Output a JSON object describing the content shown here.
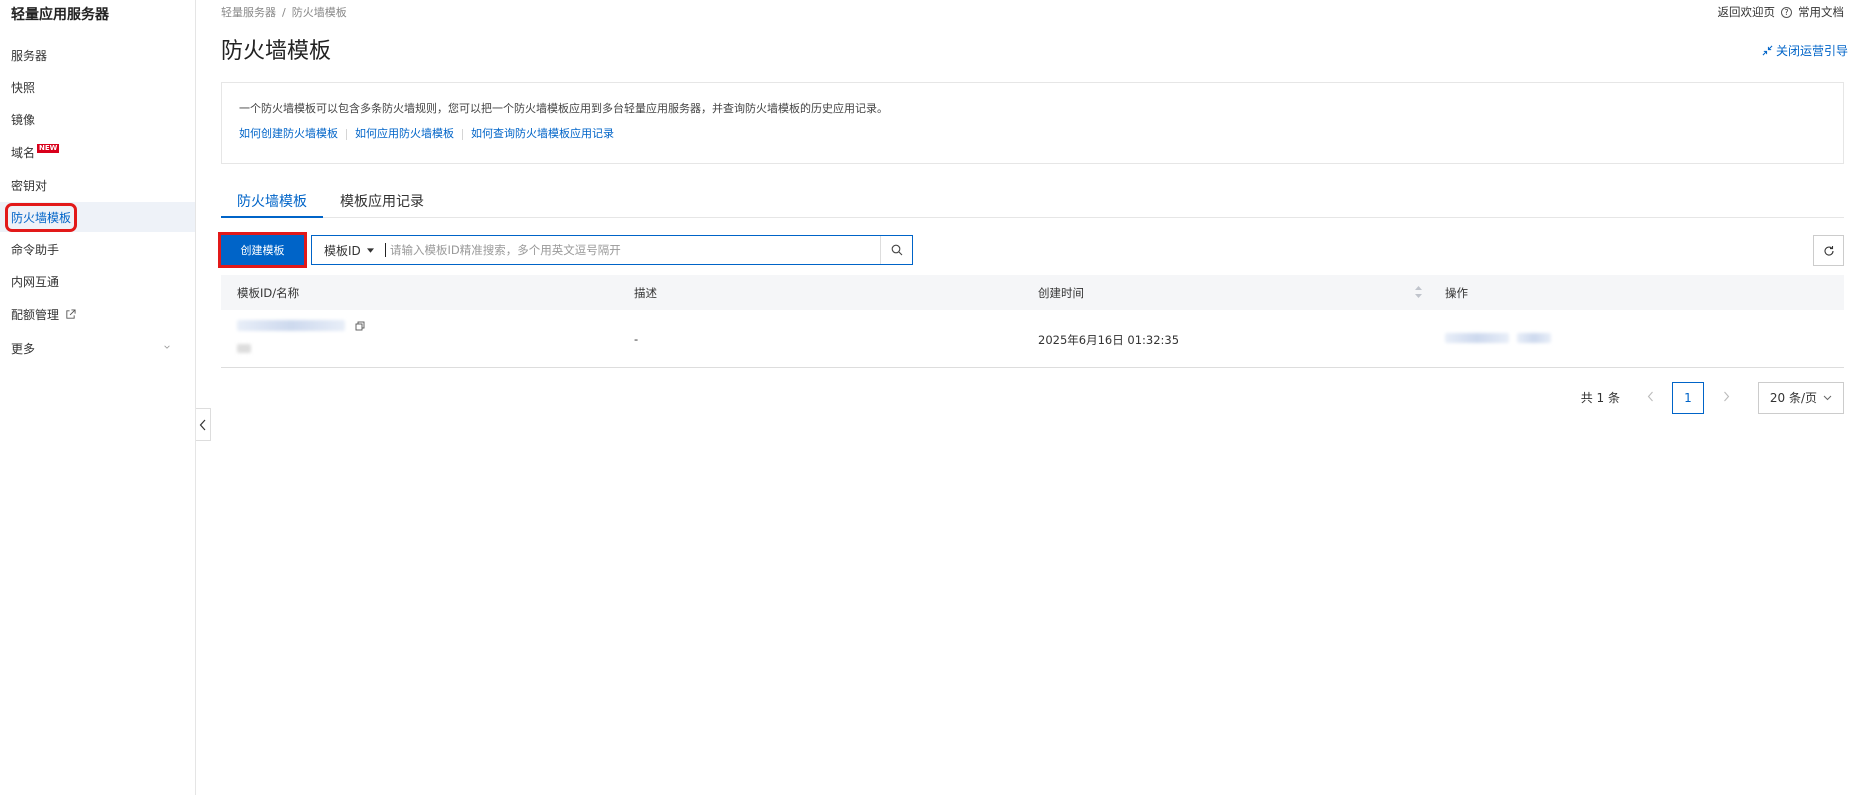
{
  "sidebar": {
    "title": "轻量应用服务器",
    "items": [
      {
        "label": "服务器"
      },
      {
        "label": "快照"
      },
      {
        "label": "镜像"
      },
      {
        "label": "域名",
        "badge": "NEW"
      },
      {
        "label": "密钥对"
      },
      {
        "label": "防火墙模板",
        "active": true
      },
      {
        "label": "命令助手"
      },
      {
        "label": "内网互通"
      },
      {
        "label": "配额管理"
      },
      {
        "label": "更多"
      }
    ]
  },
  "breadcrumb": {
    "root": "轻量服务器",
    "separator": "/",
    "current": "防火墙模板"
  },
  "header": {
    "back_link": "返回欢迎页",
    "docs_link": "常用文档",
    "page_title": "防火墙模板",
    "close_guide": "关闭运营引导"
  },
  "info": {
    "text": "一个防火墙模板可以包含多条防火墙规则，您可以把一个防火墙模板应用到多台轻量应用服务器，并查询防火墙模板的历史应用记录。",
    "links": [
      "如何创建防火墙模板",
      "如何应用防火墙模板",
      "如何查询防火墙模板应用记录"
    ]
  },
  "tabs": [
    {
      "label": "防火墙模板",
      "active": true
    },
    {
      "label": "模板应用记录"
    }
  ],
  "toolbar": {
    "create_label": "创建模板",
    "search_field": "模板ID",
    "search_placeholder": "请输入模板ID精准搜索，多个用英文逗号隔开"
  },
  "table": {
    "columns": [
      "模板ID/名称",
      "描述",
      "创建时间",
      "操作"
    ],
    "rows": [
      {
        "description": "-",
        "created": "2025年6月16日 01:32:35"
      }
    ]
  },
  "pagination": {
    "total": "共 1 条",
    "current_page": "1",
    "page_size": "20 条/页"
  },
  "colors": {
    "accent": "#0064c8",
    "highlight": "#e21919",
    "badge": "#d9001b"
  }
}
